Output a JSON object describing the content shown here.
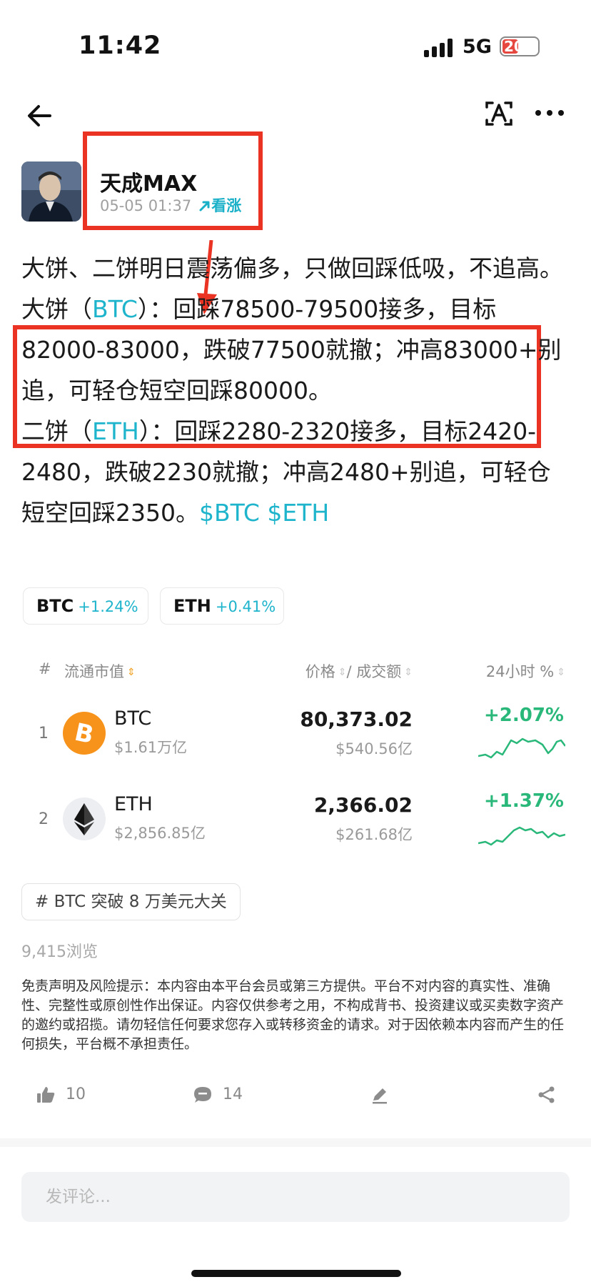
{
  "status_bar": {
    "time": "11:42",
    "network": "5G",
    "battery": "20"
  },
  "author": {
    "name": "天成MAX",
    "timestamp": "05-05 01:37",
    "sentiment": "看涨"
  },
  "post": {
    "intro": "大饼、二饼明日震荡偏多，只做回踩低吸，不追高。",
    "btc_pre": "大饼（",
    "btc_ticker": "BTC",
    "btc_post": "）：回踩78500-79500接多，目标82000-83000，跌破77500就撤；冲高83000+别追，可轻仓短空回踩80000。",
    "eth_pre": "二饼（",
    "eth_ticker": "ETH",
    "eth_post": "）：回踩2280-2320接多，目标2420-2480，跌破2230就撤；冲高2480+别追，可轻仓短空回踩2350。",
    "tag_btc": "$BTC",
    "tag_eth": "$ETH"
  },
  "chips": [
    {
      "symbol": "BTC",
      "change": "+1.24%"
    },
    {
      "symbol": "ETH",
      "change": "+0.41%"
    }
  ],
  "market": {
    "headers": {
      "num": "#",
      "cap": "流通市值",
      "price": "价格",
      "volume": "/ 成交额",
      "change": "24小时 %"
    },
    "rows": [
      {
        "rank": "1",
        "symbol": "BTC",
        "cap": "$1.61万亿",
        "price": "80,373.02",
        "volume": "$540.56亿",
        "change": "+2.07%",
        "logo_color": "#f7931a"
      },
      {
        "rank": "2",
        "symbol": "ETH",
        "cap": "$2,856.85亿",
        "price": "2,366.02",
        "volume": "$261.68亿",
        "change": "+1.37%",
        "logo_color": "#e9ebef"
      }
    ]
  },
  "topic": {
    "hash": "#",
    "label": "BTC 突破 8 万美元大关"
  },
  "views": "9,415浏览",
  "disclaimer": "免责声明及风险提示：本内容由本平台会员或第三方提供。平台不对内容的真实性、准确性、完整性或原创性作出保证。内容仅供参考之用，不构成背书、投资建议或买卖数字资产的邀约或招揽。请勿轻信任何要求您存入或转移资金的请求。对于因依赖本内容而产生的任何损失，平台概不承担责任。",
  "actions": {
    "likes": "10",
    "comments": "14"
  },
  "comment_placeholder": "发评论...",
  "colors": {
    "accent": "#1eb4cc",
    "up": "#2ab87a",
    "highlight": "#ea3323"
  }
}
